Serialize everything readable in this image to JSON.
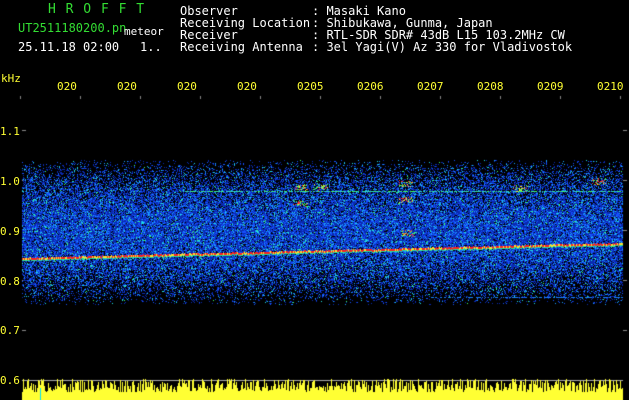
{
  "header": {
    "app_name": "H R O F F T",
    "filename": "UT2511180200.pn",
    "meteor_label": "meteor",
    "datetime": "25.11.18 02:00",
    "count": "1..",
    "labels": [
      "Observer",
      "Receiving Location",
      "Receiver",
      "Receiving Antenna"
    ],
    "values": [
      ": Masaki Kano",
      ": Shibukawa, Gunma, Japan",
      ": RTL-SDR SDR# 43dB L15 103.2MHz CW",
      ": 3el Yagi(V) Az 330 for Vladivostok"
    ]
  },
  "axis": {
    "unit": "kHz",
    "y_ticks": [
      "1.1",
      "1.0",
      "0.9",
      "0.8",
      "0.7",
      "0.6"
    ],
    "x_ticks": [
      "020",
      "020",
      "020",
      "020",
      "0205",
      "0206",
      "0207",
      "0208",
      "0209",
      "0210"
    ]
  },
  "colors": {
    "background": "#000000",
    "title_green": "#33dd33",
    "axis_yellow": "#ffff33",
    "signal_red": "#ff2020",
    "noise_blue": "#1040ff",
    "cyan": "#00e0ff"
  }
}
